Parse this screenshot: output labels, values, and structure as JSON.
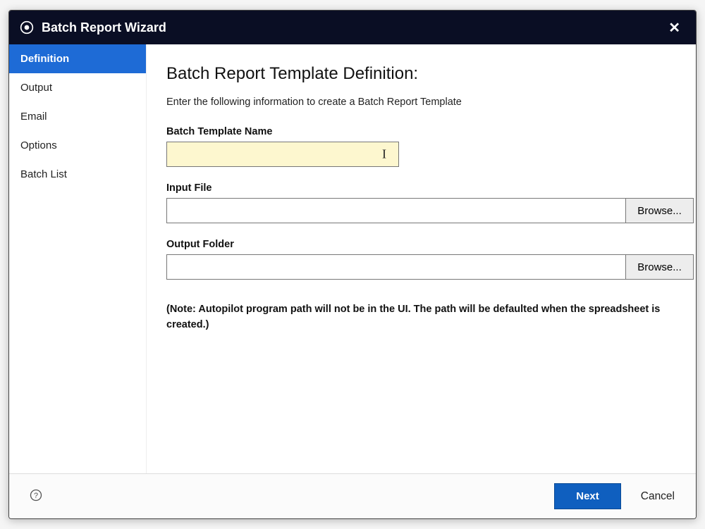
{
  "titlebar": {
    "title": "Batch Report Wizard"
  },
  "sidebar": {
    "items": [
      {
        "label": "Definition",
        "active": true
      },
      {
        "label": "Output",
        "active": false
      },
      {
        "label": "Email",
        "active": false
      },
      {
        "label": "Options",
        "active": false
      },
      {
        "label": "Batch List",
        "active": false
      }
    ]
  },
  "content": {
    "heading": "Batch Report Template Definition:",
    "description": "Enter the following information to create a Batch Report Template",
    "fields": {
      "template_name": {
        "label": "Batch Template Name",
        "value": ""
      },
      "input_file": {
        "label": "Input File",
        "value": "",
        "browse_label": "Browse..."
      },
      "output_folder": {
        "label": "Output Folder",
        "value": "",
        "browse_label": "Browse..."
      }
    },
    "note": "(Note: Autopilot program path will not be in the UI. The path will be defaulted when the spreadsheet is created.)"
  },
  "footer": {
    "next_label": "Next",
    "cancel_label": "Cancel"
  }
}
